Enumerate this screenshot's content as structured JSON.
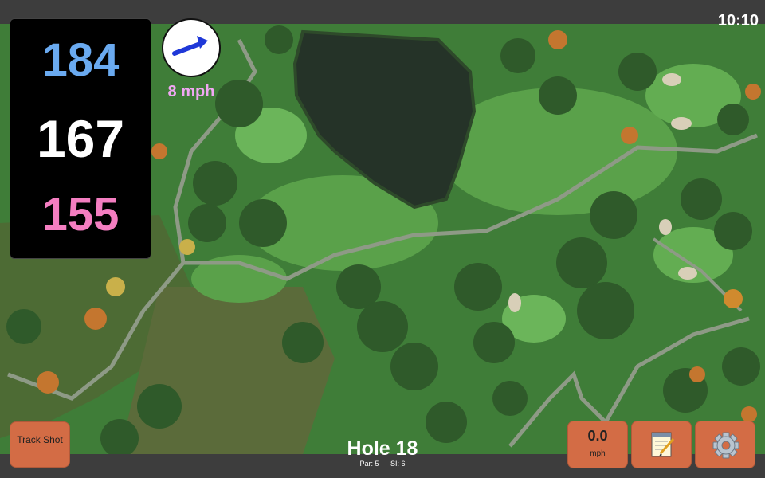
{
  "status": {
    "time": "10:10"
  },
  "distances": {
    "back": "184",
    "center": "167",
    "front": "155"
  },
  "wind": {
    "speed": "8 mph",
    "icon": "wind-arrow-icon"
  },
  "actions": {
    "track_shot": "Track Shot"
  },
  "shot_speed": {
    "value": "0.0",
    "unit": "mph"
  },
  "hole": {
    "title": "Hole 18",
    "par": "Par: 5",
    "si": "SI: 6"
  },
  "icons": {
    "notes": "notepad-icon",
    "settings": "gear-icon"
  },
  "colors": {
    "back_distance": "#6aaaf0",
    "center_distance": "#ffffff",
    "front_distance": "#f47ec1",
    "wind_text": "#f1a7f3",
    "button": "#d36c45"
  }
}
